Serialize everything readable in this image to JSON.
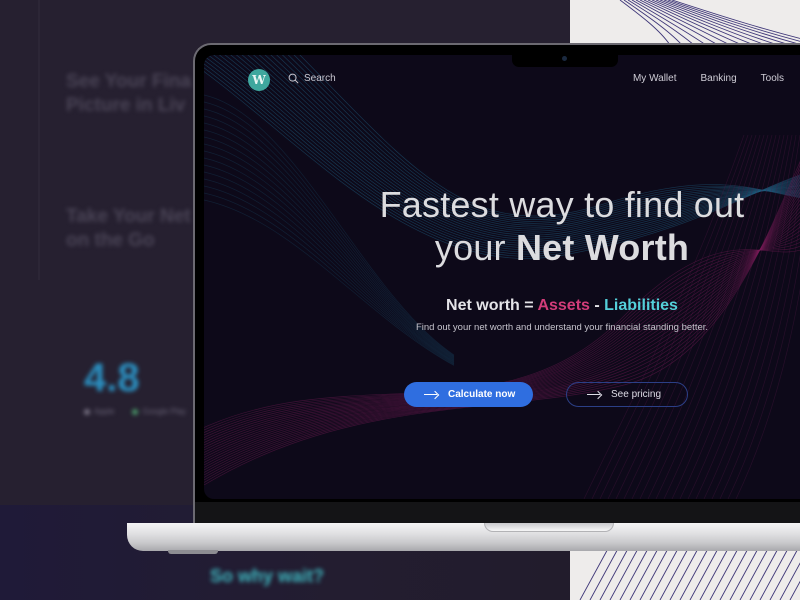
{
  "background_page": {
    "feature_1": "See Your Financial Picture in Live",
    "feature_1_line1": "See Your Fina",
    "feature_1_line2": "Picture in Liv",
    "feature_2_line1": "Take Your Net",
    "feature_2_line2": "on the Go",
    "rating": "4.8",
    "rating_sources": [
      "Apple",
      "Google Play"
    ],
    "cta_heading": "So why wait?"
  },
  "nav": {
    "logo_letter": "W",
    "search_label": "Search",
    "links": [
      "My Wallet",
      "Banking",
      "Tools"
    ]
  },
  "hero": {
    "title_line1": "Fastest way to find out",
    "title_line2_prefix": "your ",
    "title_line2_bold": "Net Worth",
    "formula_prefix": "Net worth = ",
    "formula_assets": "Assets",
    "formula_sep": " - ",
    "formula_liabilities": "Liabilities",
    "subtitle": "Find out your net worth and understand your financial standing better.",
    "primary_button": "Calculate now",
    "secondary_button": "See pricing"
  },
  "colors": {
    "screen_bg": "#0d0919",
    "logo": "#3fa79e",
    "assets": "#d13c79",
    "liabilities": "#54cfd9",
    "primary_button": "#2f6ee0",
    "secondary_border": "#2b3f86"
  }
}
